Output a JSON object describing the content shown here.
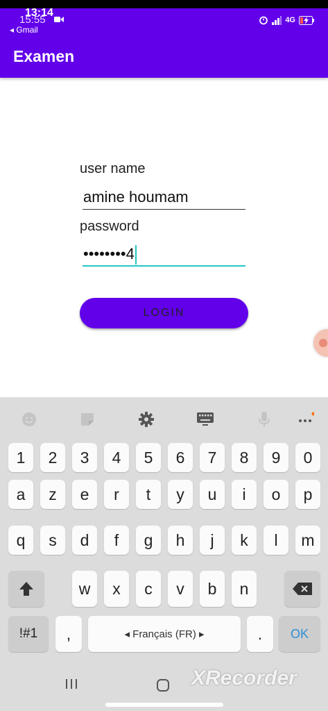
{
  "status_bar": {
    "time": "13:14",
    "time_previous": "15:55",
    "back_app": "◂ Gmail",
    "network": "4G",
    "colors": {
      "background": "#6200ea",
      "top_strip": "#000000"
    },
    "icons": [
      "camera-icon",
      "alarm-icon",
      "signal-icon",
      "battery-icon"
    ]
  },
  "app_bar": {
    "title": "Examen"
  },
  "form": {
    "username_label": "user name",
    "username_value": "amine houmam",
    "password_label": "password",
    "password_value": "••••••••4",
    "login_label": "LOGIN"
  },
  "keyboard": {
    "toolbar_icons": [
      "emoji-icon",
      "sticker-icon",
      "settings-icon",
      "keyboard-icon",
      "mic-icon",
      "more-icon"
    ],
    "row1": [
      "1",
      "2",
      "3",
      "4",
      "5",
      "6",
      "7",
      "8",
      "9",
      "0"
    ],
    "row2": [
      "a",
      "z",
      "e",
      "r",
      "t",
      "y",
      "u",
      "i",
      "o",
      "p"
    ],
    "row3": [
      "q",
      "s",
      "d",
      "f",
      "g",
      "h",
      "j",
      "k",
      "l",
      "m"
    ],
    "row4": [
      "w",
      "x",
      "c",
      "v",
      "b",
      "n"
    ],
    "symbols_label": "!#1",
    "comma_label": ",",
    "space_label": "◂  Français (FR)  ▸",
    "period_label": ".",
    "ok_label": "OK"
  },
  "watermark": "XRecorder",
  "colors": {
    "accent": "#6200ea",
    "focus_underline": "#26c6c6",
    "ok_key": "#2b8fd6"
  }
}
